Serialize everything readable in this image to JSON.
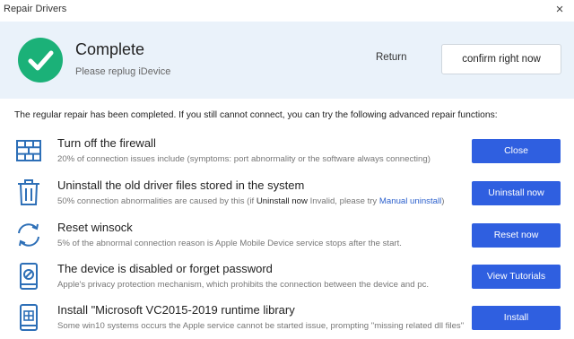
{
  "window": {
    "title": "Repair Drivers",
    "close_glyph": "×"
  },
  "header": {
    "status_title": "Complete",
    "status_subtitle": "Please replug iDevice",
    "return_label": "Return",
    "confirm_label": "confirm right now",
    "status_icon": "check-circle-icon"
  },
  "intro": "The regular repair has been completed. If you still cannot connect, you can try the following advanced repair functions:",
  "options": [
    {
      "icon": "firewall-icon",
      "title": "Turn off the firewall",
      "desc": "20% of connection issues include (symptoms: port abnormality or the software always connecting)",
      "button": "Close"
    },
    {
      "icon": "trash-icon",
      "title": "Uninstall the old driver files stored in the system",
      "desc_pre": "50% connection abnormalities are caused by this (if ",
      "desc_em": "Uninstall now",
      "desc_mid": " Invalid, please try ",
      "desc_link": "Manual uninstall",
      "desc_post": ")",
      "button": "Uninstall now"
    },
    {
      "icon": "refresh-icon",
      "title": "Reset winsock",
      "desc": "5% of the abnormal connection reason is Apple Mobile Device service stops after the start.",
      "button": "Reset now"
    },
    {
      "icon": "disabled-device-icon",
      "title": "The device is disabled or forget password",
      "desc": "Apple's privacy protection mechanism, which prohibits the connection between the device and pc.",
      "button": "View Tutorials"
    },
    {
      "icon": "windows-icon",
      "title": "Install \"Microsoft VC2015-2019 runtime library",
      "desc": "Some win10 systems occurs the Apple service cannot be started issue, prompting \"missing related dll files\"",
      "button": "Install"
    }
  ],
  "colors": {
    "accent": "#2f5fe0",
    "success": "#1bb178",
    "header_bg": "#eaf2fa",
    "icon": "#2d6fb7"
  }
}
